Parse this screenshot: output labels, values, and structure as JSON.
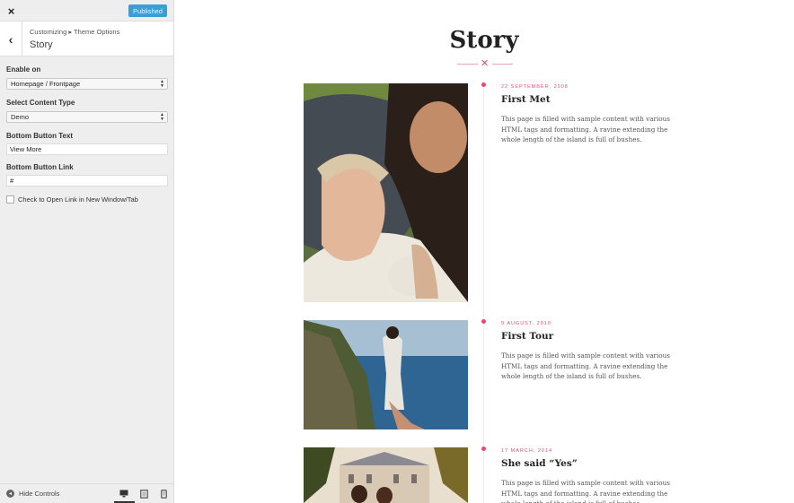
{
  "topbar": {
    "close_glyph": "×",
    "publish_label": "Published"
  },
  "section": {
    "back_glyph": "‹",
    "breadcrumb": "Customizing ▸ Theme Options",
    "title": "Story"
  },
  "controls": {
    "enable_on": {
      "label": "Enable on",
      "value": "Homepage / Frontpage"
    },
    "content_type": {
      "label": "Select Content Type",
      "value": "Demo"
    },
    "button_text": {
      "label": "Bottom Button Text",
      "value": "View More"
    },
    "button_link": {
      "label": "Bottom Button Link",
      "value": "#"
    },
    "new_window": {
      "label": "Check to Open Link in New Window/Tab",
      "checked": false
    }
  },
  "footer": {
    "hide_label": "Hide Controls",
    "hide_glyph": "◂",
    "devices": [
      "desktop-icon",
      "tablet-icon",
      "mobile-icon"
    ]
  },
  "preview": {
    "title": "Story",
    "divider_glyph": "✕",
    "entries": [
      {
        "date": "22 September, 2008",
        "title": "First Met",
        "text": "This page is filled with sample content with various HTML tags and formatting. A ravine extending the whole length of the island is full of bushes."
      },
      {
        "date": "9 August, 2010",
        "title": "First Tour",
        "text": "This page is filled with sample content with various HTML tags and formatting. A ravine extending the whole length of the island is full of bushes."
      },
      {
        "date": "17 March, 2014",
        "title": "She said “Yes”",
        "text": "This page is filled with sample content with various HTML tags and formatting. A ravine extending the whole length of the island is full of bushes."
      }
    ]
  },
  "colors": {
    "publish_bg": "#3a9fd3",
    "accent_pink": "#e74a6a",
    "sidebar_bg": "#eeeeee"
  }
}
